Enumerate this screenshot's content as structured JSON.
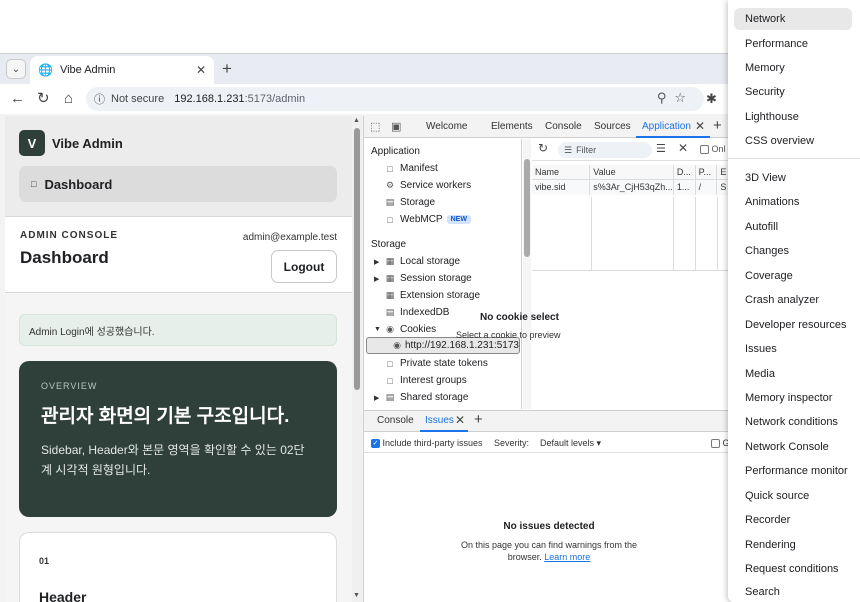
{
  "browser": {
    "tab_title": "Vibe Admin",
    "url_security": "Not secure",
    "url_host": "192.168.1.231",
    "url_path": ":5173/admin"
  },
  "app": {
    "logo_letter": "V",
    "brand": "Vibe Admin",
    "nav_dashboard": "Dashboard",
    "eyebrow": "ADMIN CONSOLE",
    "page_title": "Dashboard",
    "user_email": "admin@example.test",
    "logout_label": "Logout",
    "alert_text": "Admin Login에 성공했습니다.",
    "hero": {
      "eyebrow": "OVERVIEW",
      "title": "관리자 화면의 기본 구조입니다.",
      "description_1": "Sidebar, Header와 본문 영역을 확인할 수 있는 02단",
      "description_2": "계 시각적 원형입니다."
    },
    "card": {
      "number": "01",
      "title": "Header"
    }
  },
  "devtools": {
    "tabs": [
      "Welcome",
      "Elements",
      "Console",
      "Sources",
      "Application"
    ],
    "active_tab": "Application",
    "tree": {
      "application_header": "Application",
      "application_items": [
        "Manifest",
        "Service workers",
        "Storage",
        "WebMCP"
      ],
      "new_badge": "NEW",
      "storage_header": "Storage",
      "storage_items": [
        "Local storage",
        "Session storage",
        "Extension storage",
        "IndexedDB",
        "Cookies"
      ],
      "cookie_origin": "http://192.168.1.231:5173",
      "more_items": [
        "Private state tokens",
        "Interest groups",
        "Shared storage"
      ]
    },
    "cookies": {
      "filter_placeholder": "Filter",
      "only_label": "Onl",
      "columns": [
        "Name",
        "Value",
        "D...",
        "P...",
        "E"
      ],
      "row": [
        "vibe.sid",
        "s%3Ar_CjH53qZh...",
        "1...",
        "/",
        "S"
      ],
      "empty_title": "No cookie select",
      "empty_sub": "Select a cookie to preview"
    },
    "drawer": {
      "tabs": [
        "Console",
        "Issues"
      ],
      "active_tab": "Issues",
      "third_party_label": "Include third-party issues",
      "severity_label": "Severity:",
      "severity_value": "Default levels",
      "cut_label": "G",
      "no_issues_title": "No issues detected",
      "no_issues_sub_1": "On this page you can find warnings from the",
      "no_issues_sub_2": "browser.",
      "learn_more": "Learn more"
    }
  },
  "menu": {
    "group1": [
      "Network",
      "Performance",
      "Memory",
      "Security",
      "Lighthouse",
      "CSS overview"
    ],
    "group2": [
      "3D View",
      "Animations",
      "Autofill",
      "Changes",
      "Coverage",
      "Crash analyzer",
      "Developer resources",
      "Issues",
      "Media",
      "Memory inspector",
      "Network conditions",
      "Network Console",
      "Performance monitor",
      "Quick source",
      "Recorder",
      "Rendering",
      "Request conditions",
      "Search"
    ],
    "highlighted": "Network"
  }
}
